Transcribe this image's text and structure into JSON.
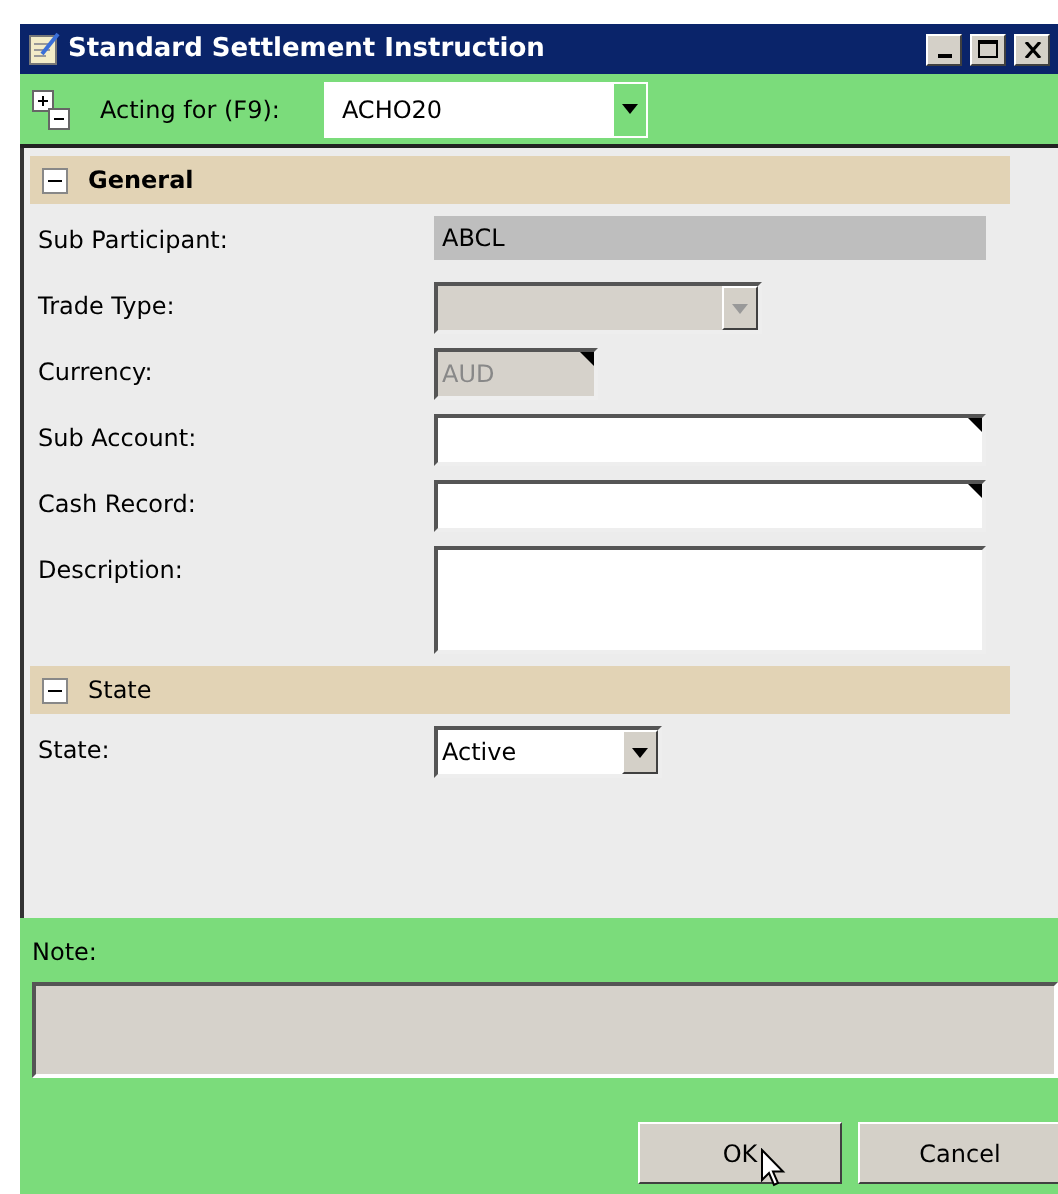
{
  "window": {
    "title": "Standard Settlement Instruction"
  },
  "toolbar": {
    "label": "Acting for (F9):",
    "value": "ACHO20"
  },
  "sections": [
    {
      "title": "General",
      "bold": true,
      "expanded": true,
      "fields": [
        {
          "label": "Sub Participant:",
          "kind": "readonly",
          "value": "ABCL"
        },
        {
          "label": "Trade Type:",
          "kind": "select",
          "disabled": true
        },
        {
          "label": "Currency:",
          "kind": "short",
          "disabled": true,
          "value": "AUD"
        },
        {
          "label": "Sub Account:",
          "kind": "text",
          "disabled": false
        },
        {
          "label": "Cash Record:",
          "kind": "text",
          "disabled": false
        },
        {
          "label": "Description:",
          "kind": "textarea",
          "disabled": false
        }
      ]
    },
    {
      "title": "State",
      "bold": false,
      "expanded": true,
      "fields": [
        {
          "label": "State:",
          "kind": "select",
          "disabled": false,
          "value": "Active"
        }
      ]
    }
  ],
  "note": {
    "label": "Note:"
  },
  "buttons": [
    {
      "label": "OK",
      "hovered": true
    },
    {
      "label": "Cancel",
      "hovered": false
    }
  ]
}
